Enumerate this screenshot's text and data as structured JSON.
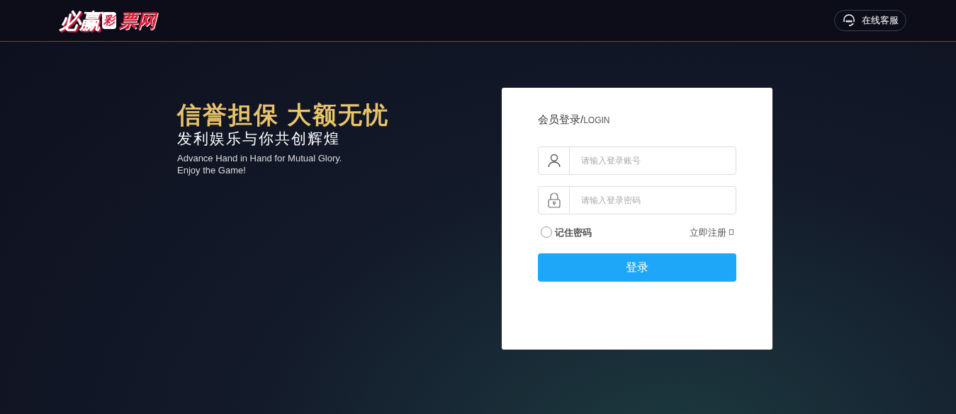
{
  "header": {
    "logo": {
      "main": "必赢",
      "mark": "彩",
      "tail": "票网"
    },
    "support_button": "在线客服"
  },
  "hero": {
    "slogan": "信誉担保 大额无忧",
    "subtitle": "发利娱乐与你共创辉煌",
    "english": [
      "Advance Hand in Hand for Mutual Glory.",
      "Enjoy the Game!"
    ]
  },
  "login": {
    "title": "会员登录/",
    "title_en": "LOGIN",
    "fields": [
      {
        "kind": "user",
        "placeholder": "请输入登录账号"
      },
      {
        "kind": "password",
        "placeholder": "请输入登录密码"
      }
    ],
    "remember": {
      "label": "记住密码",
      "checked": false
    },
    "register_link": "立即注册",
    "submit": "登录"
  }
}
